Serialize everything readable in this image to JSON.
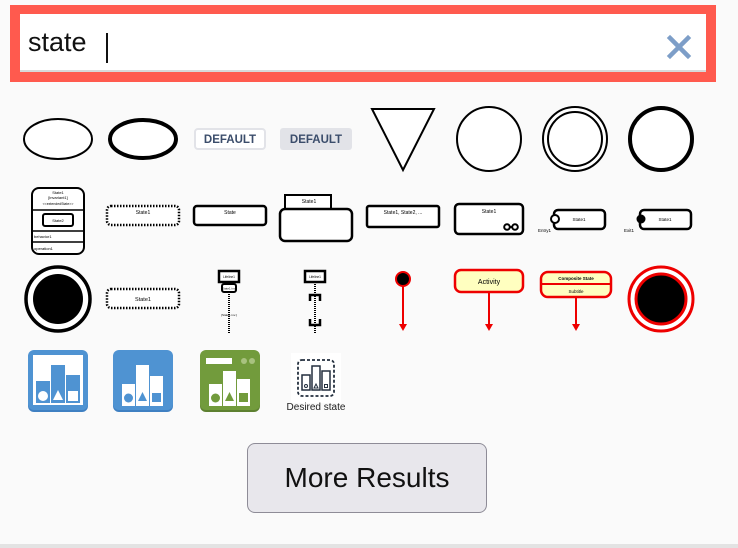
{
  "search": {
    "value": "state",
    "placeholder": "",
    "clear_icon": "close-icon",
    "border_color": "#ff5a4e"
  },
  "results": {
    "row1": [
      {
        "name": "ellipse",
        "label": ""
      },
      {
        "name": "ellipse-thick",
        "label": ""
      },
      {
        "name": "label-default-outline",
        "label": "DEFAULT"
      },
      {
        "name": "label-default-filled",
        "label": "DEFAULT"
      },
      {
        "name": "triangle-down",
        "label": ""
      },
      {
        "name": "circle",
        "label": ""
      },
      {
        "name": "double-circle",
        "label": ""
      },
      {
        "name": "thick-circle",
        "label": ""
      }
    ],
    "row2": [
      {
        "name": "composite-state-detailed",
        "lines": [
          "State1",
          "[invariant1]",
          "<<extendedState>>",
          "State2",
          "behavior1",
          "operation1"
        ]
      },
      {
        "name": "state-dashed",
        "label": "State1"
      },
      {
        "name": "state-simple",
        "label": "State"
      },
      {
        "name": "state-with-tab",
        "label": "State1"
      },
      {
        "name": "state-list",
        "label": "State1, State2, ..."
      },
      {
        "name": "state-composite-icon",
        "label": "State1"
      },
      {
        "name": "state-entry-point",
        "label": "State1",
        "point_label": "Entry1"
      },
      {
        "name": "state-exit-point",
        "label": "State1",
        "point_label": "Exit1"
      }
    ],
    "row3": [
      {
        "name": "final-state",
        "label": ""
      },
      {
        "name": "state-dashed-wide",
        "label": "State1"
      },
      {
        "name": "lifeline-state-invariant",
        "label": "Lifeline1",
        "sub": "State1 inv.",
        "note": "{State1 inv.}"
      },
      {
        "name": "lifeline-continuation",
        "label": "Lifeline1"
      },
      {
        "name": "initial-state-red",
        "label": ""
      },
      {
        "name": "activity-state",
        "label": "Activity"
      },
      {
        "name": "composite-state-red",
        "label": "Composite State",
        "sub": "Subtitle"
      },
      {
        "name": "final-state-red",
        "label": ""
      }
    ],
    "row4": [
      {
        "name": "aws-state-outline-icon",
        "label": ""
      },
      {
        "name": "aws-state-blue-icon",
        "label": ""
      },
      {
        "name": "aws-state-green-icon",
        "label": ""
      },
      {
        "name": "desired-state-icon",
        "label": "Desired state"
      }
    ]
  },
  "colors": {
    "blue": "#4f93d2",
    "green": "#729b3c",
    "red": "#ee0000",
    "yellow": "#ffffc0"
  },
  "more_button": {
    "label": "More Results"
  }
}
